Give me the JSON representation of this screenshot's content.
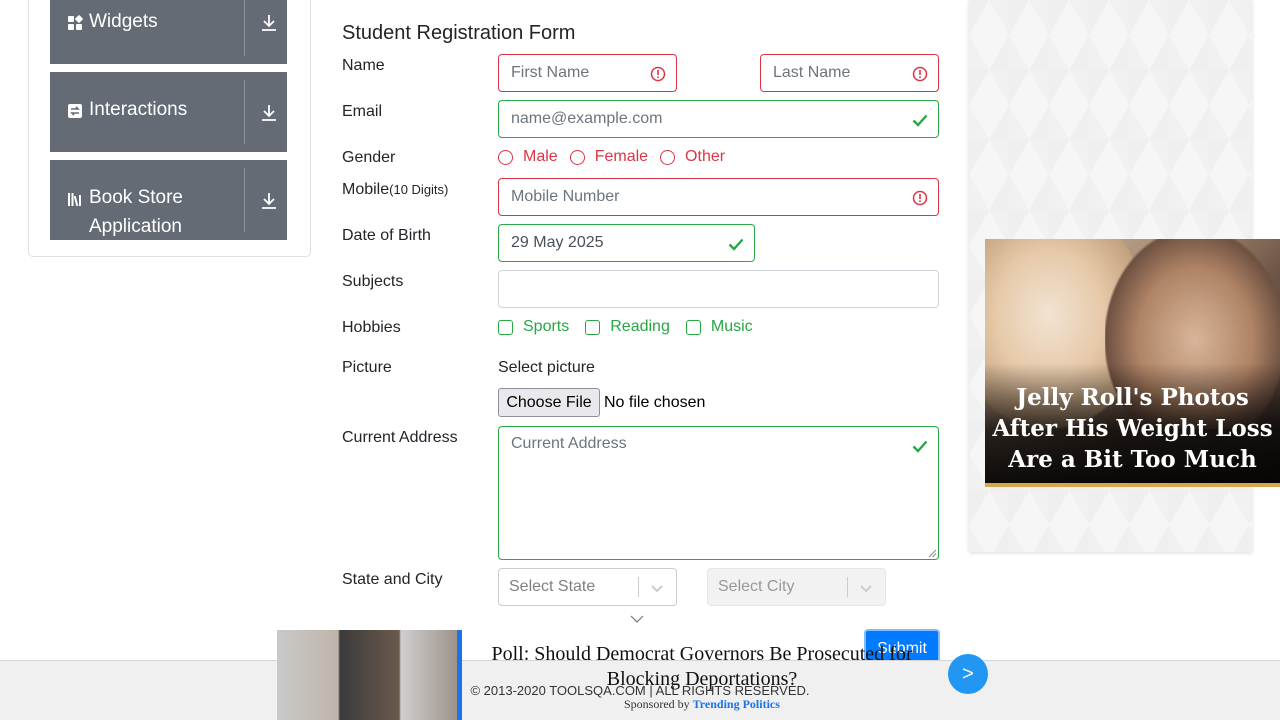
{
  "sidebar": {
    "groups": [
      {
        "label": "Widgets",
        "icon": "widgets-icon"
      },
      {
        "label": "Interactions",
        "icon": "interactions-icon"
      },
      {
        "label": "Book Store Application",
        "icon": "book-store-icon"
      }
    ]
  },
  "form": {
    "title": "Student Registration Form",
    "name_label": "Name",
    "first_name_placeholder": "First Name",
    "last_name_placeholder": "Last Name",
    "email_label": "Email",
    "email_placeholder": "name@example.com",
    "gender_label": "Gender",
    "gender_options": [
      "Male",
      "Female",
      "Other"
    ],
    "mobile_label": "Mobile",
    "mobile_hint": "(10 Digits)",
    "mobile_placeholder": "Mobile Number",
    "dob_label": "Date of Birth",
    "dob_value": "29 May 2025",
    "subjects_label": "Subjects",
    "hobbies_label": "Hobbies",
    "hobbies_options": [
      "Sports",
      "Reading",
      "Music"
    ],
    "picture_label": "Picture",
    "picture_select_text": "Select picture",
    "choose_file_label": "Choose File",
    "no_file_text": "No file chosen",
    "address_label": "Current Address",
    "address_placeholder": "Current Address",
    "state_city_label": "State and City",
    "state_placeholder": "Select State",
    "city_placeholder": "Select City",
    "submit_label": "Submit"
  },
  "right_ad": {
    "headline": "Jelly Roll's Photos After His Weight Loss Are a Bit Too Much"
  },
  "bottom_ad": {
    "poll_text": "Poll: Should Democrat Governors Be Prosecuted for Blocking Deportations?",
    "sponsored_prefix": "Sponsored by",
    "sponsor_name": "Trending Politics",
    "next_label": ">"
  },
  "footer": {
    "copyright": "© 2013-2020 TOOLSQA.COM | ALL RIGHTS RESERVED."
  },
  "colors": {
    "invalid": "#dc3545",
    "valid": "#28a745",
    "primary": "#007bff",
    "sidebar_bg": "#646b75"
  }
}
